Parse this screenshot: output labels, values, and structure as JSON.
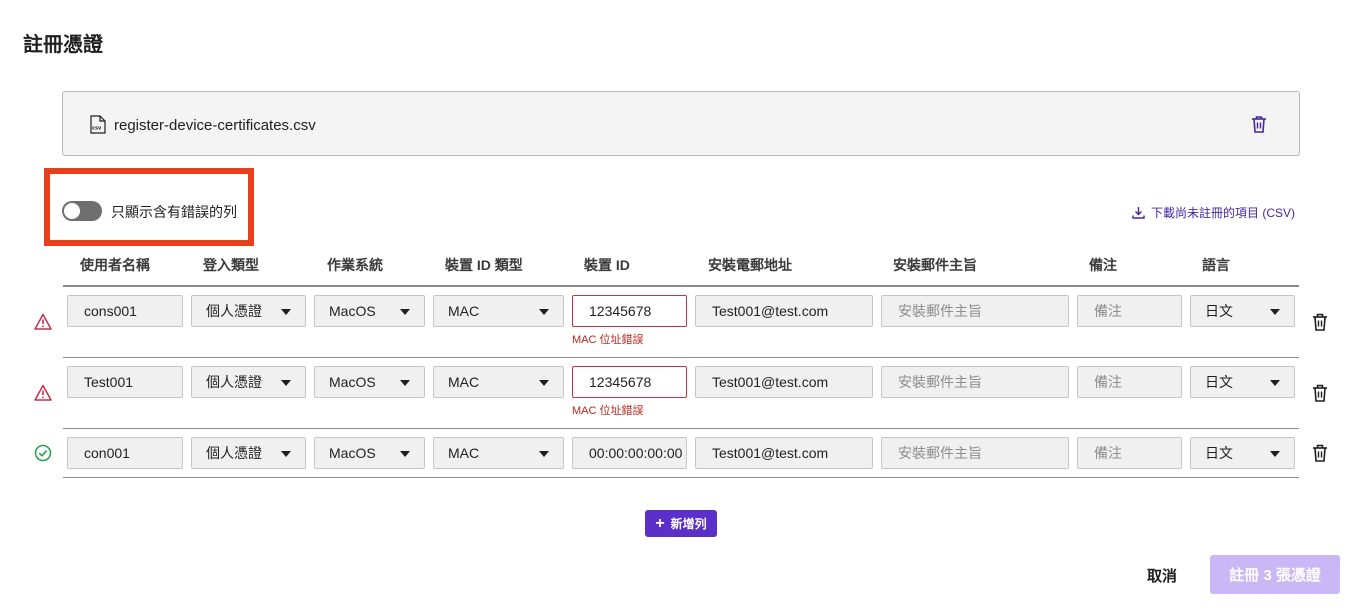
{
  "page": {
    "title": "註冊憑證"
  },
  "file": {
    "name": "register-device-certificates.csv",
    "icon": "csv-file-icon"
  },
  "filter": {
    "label": "只顯示含有錯誤的列",
    "enabled": false
  },
  "download": {
    "label": "下載尚未註冊的項目 (CSV)"
  },
  "columns": [
    "使用者名稱",
    "登入類型",
    "作業系統",
    "裝置 ID 類型",
    "裝置 ID",
    "安裝電郵地址",
    "安裝郵件主旨",
    "備注",
    "語言"
  ],
  "rows": [
    {
      "status": "error",
      "username": "cons001",
      "login_type": "個人憑證",
      "os": "MacOS",
      "device_id_type": "MAC",
      "device_id": "12345678",
      "device_id_error": "MAC 位址錯誤",
      "email": "Test001@test.com",
      "subject_placeholder": "安裝郵件主旨",
      "note_placeholder": "備注",
      "language": "日文"
    },
    {
      "status": "error",
      "username": "Test001",
      "login_type": "個人憑證",
      "os": "MacOS",
      "device_id_type": "MAC",
      "device_id": "12345678",
      "device_id_error": "MAC 位址錯誤",
      "email": "Test001@test.com",
      "subject_placeholder": "安裝郵件主旨",
      "note_placeholder": "備注",
      "language": "日文"
    },
    {
      "status": "ok",
      "username": "con001",
      "login_type": "個人憑證",
      "os": "MacOS",
      "device_id_type": "MAC",
      "device_id": "00:00:00:00:00",
      "device_id_error": "",
      "email": "Test001@test.com",
      "subject_placeholder": "安裝郵件主旨",
      "note_placeholder": "備注",
      "language": "日文"
    }
  ],
  "actions": {
    "add_row": "新增列",
    "cancel": "取消",
    "register": "註冊 3 張憑證"
  },
  "colors": {
    "accent": "#5b2fc9",
    "error": "#c4314b",
    "success": "#24a148",
    "highlight": "#e8401c"
  }
}
